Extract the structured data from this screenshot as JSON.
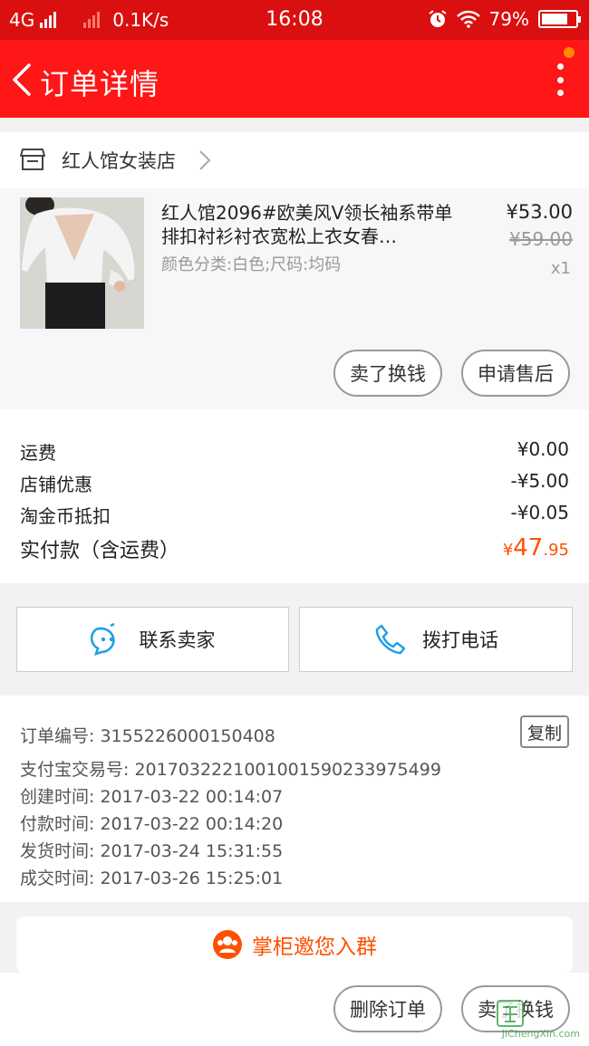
{
  "status_bar": {
    "network": "4G",
    "speed": "0.1K/s",
    "time": "16:08",
    "battery": "79%",
    "battery_level": 0.79
  },
  "header": {
    "title": "订单详情"
  },
  "shop": {
    "name": "红人馆女装店"
  },
  "product": {
    "title": "红人馆2096#欧美风V领长袖系带单排扣衬衫衬衣宽松上衣女春…",
    "spec": "颜色分类:白色;尺码:均码",
    "price": "¥53.00",
    "original_price": "¥59.00",
    "quantity": "x1",
    "actions": [
      "卖了换钱",
      "申请售后"
    ]
  },
  "fees": [
    {
      "label": "运费",
      "value": "¥0.00"
    },
    {
      "label": "店铺优惠",
      "value": "-¥5.00"
    },
    {
      "label": "淘金币抵扣",
      "value": "-¥0.05"
    }
  ],
  "total": {
    "label": "实付款（含运费）",
    "currency": "¥",
    "integer": "47",
    "decimal": ".95"
  },
  "contact": {
    "seller": "联系卖家",
    "call": "拨打电话"
  },
  "order_info": {
    "copy_label": "复制",
    "rows": [
      "订单编号: 3155226000150408",
      "支付宝交易号: 2017032221001001590233975499",
      "创建时间: 2017-03-22 00:14:07",
      "付款时间: 2017-03-22 00:14:20",
      "发货时间: 2017-03-24 15:31:55",
      "成交时间: 2017-03-26 15:25:01"
    ]
  },
  "invite": {
    "label": "掌柜邀您入群"
  },
  "bottom_actions": {
    "delete": "删除订单",
    "sell": "卖了换钱"
  },
  "watermark": {
    "text": "JiChengXin.com"
  },
  "colors": {
    "header_red": "#ff1616",
    "status_red": "#d9100f",
    "accent_orange": "#ff5000",
    "icon_blue": "#1ea0e6"
  }
}
